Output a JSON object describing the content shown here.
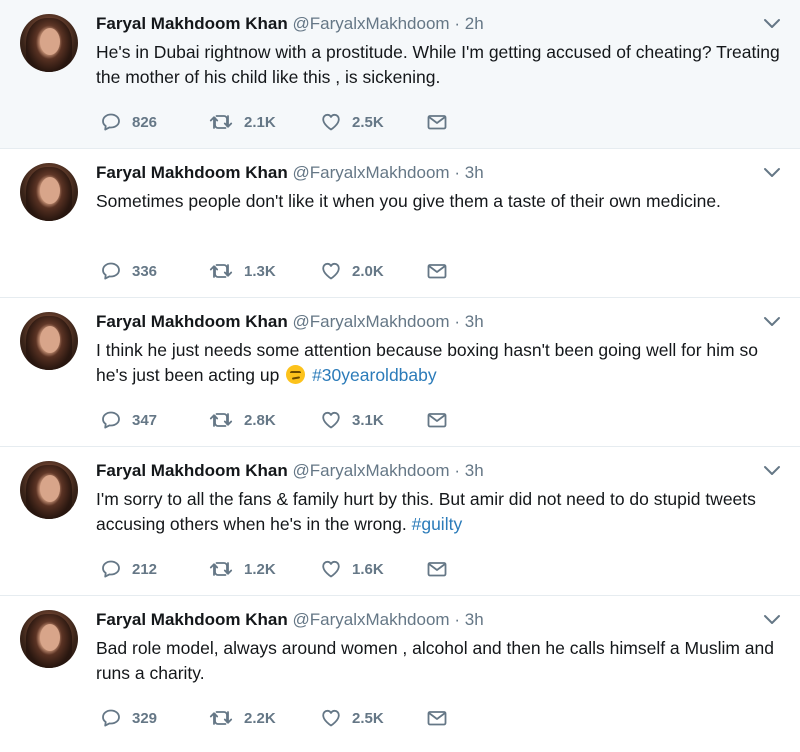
{
  "tweets": [
    {
      "name": "Faryal Makhdoom Khan",
      "handle": "@FaryalxMakhdoom",
      "time": "2h",
      "text_parts": [
        {
          "t": "He's in Dubai rightnow with a prostitude. While I'm getting accused of cheating? Treating the mother of his child like this , is sickening."
        }
      ],
      "replies": "826",
      "retweets": "2.1K",
      "likes": "2.5K"
    },
    {
      "name": "Faryal Makhdoom Khan",
      "handle": "@FaryalxMakhdoom",
      "time": "3h",
      "text_parts": [
        {
          "t": "Sometimes people don't like it when you give them a taste of their own medicine."
        }
      ],
      "replies": "336",
      "retweets": "1.3K",
      "likes": "2.0K"
    },
    {
      "name": "Faryal Makhdoom Khan",
      "handle": "@FaryalxMakhdoom",
      "time": "3h",
      "text_parts": [
        {
          "t": "I think he just needs some attention because boxing hasn't been going well for him so he's just been acting up "
        },
        {
          "emoji": "smirking-face"
        },
        {
          "t": " "
        },
        {
          "tag": "#30yearoldbaby"
        }
      ],
      "replies": "347",
      "retweets": "2.8K",
      "likes": "3.1K"
    },
    {
      "name": "Faryal Makhdoom Khan",
      "handle": "@FaryalxMakhdoom",
      "time": "3h",
      "text_parts": [
        {
          "t": "I'm sorry to all the fans & family hurt by this. But amir did not need to do stupid tweets accusing others when he's in the wrong. "
        },
        {
          "tag": "#guilty"
        }
      ],
      "replies": "212",
      "retweets": "1.2K",
      "likes": "1.6K"
    },
    {
      "name": "Faryal Makhdoom Khan",
      "handle": "@FaryalxMakhdoom",
      "time": "3h",
      "text_parts": [
        {
          "t": "Bad role model, always around women , alcohol and then he calls himself a Muslim and runs a charity."
        }
      ],
      "replies": "329",
      "retweets": "2.2K",
      "likes": "2.5K"
    }
  ],
  "separator": "·",
  "colors": {
    "text": "#14171a",
    "secondary": "#657786",
    "link": "#2b7bb9",
    "border": "#e6ecf0",
    "highlight_bg": "#f5f8fa"
  },
  "icons": {
    "reply": "reply-icon",
    "retweet": "retweet-icon",
    "like": "heart-icon",
    "dm": "envelope-icon",
    "menu": "chevron-down-icon"
  }
}
